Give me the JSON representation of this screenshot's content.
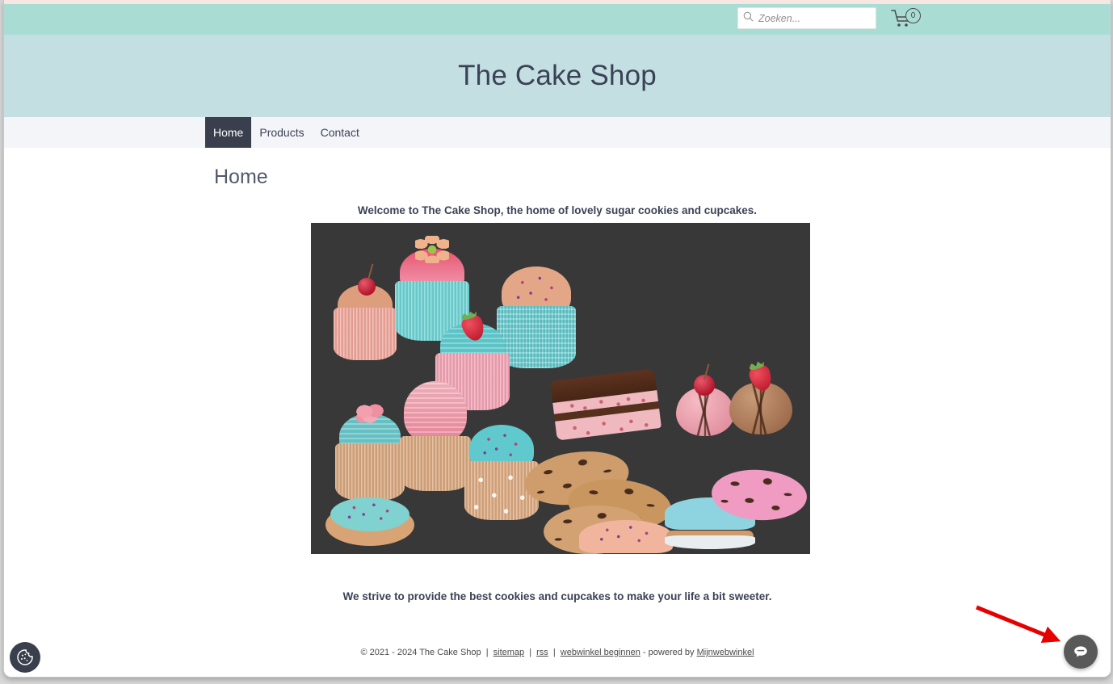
{
  "utility_bar": {
    "search": {
      "placeholder": "Zoeken...",
      "value": "",
      "icon": "search-icon"
    },
    "cart": {
      "icon": "shopping-cart-icon",
      "count": "0"
    }
  },
  "header": {
    "shop_title": "The Cake Shop",
    "background_color": "#c4dfe2",
    "top_bar_color": "#a9ddd4"
  },
  "nav": {
    "items": [
      {
        "label": "Home",
        "active": true
      },
      {
        "label": "Products",
        "active": false
      },
      {
        "label": "Contact",
        "active": false
      }
    ],
    "active_bg": "#393f4d",
    "bar_bg": "#f4f5f9"
  },
  "main": {
    "page_title": "Home",
    "intro_text": "Welcome to The Cake Shop, the home of lovely sugar cookies and cupcakes.",
    "outro_text": "We strive to provide the best cookies and cupcakes to make your life a bit sweeter.",
    "hero_image": {
      "name": "cupcakes-and-cookies-illustration",
      "background_color": "#383838"
    }
  },
  "footer": {
    "copyright": "© 2021 - 2024 The Cake Shop",
    "sep": "|",
    "sitemap_link": "sitemap",
    "rss_link": "rss",
    "webshop_link": "webwinkel beginnen",
    "powered_by": "- powered by",
    "provider_link": "Mijnwebwinkel"
  },
  "widgets": {
    "cookie_button": {
      "icon": "cookie-icon",
      "color": "#393f4d"
    },
    "chat_button": {
      "icon": "chat-bubble-icon",
      "color": "#595959"
    },
    "annotation_arrow": {
      "color": "#e60000",
      "points_to": "chat-button"
    }
  }
}
